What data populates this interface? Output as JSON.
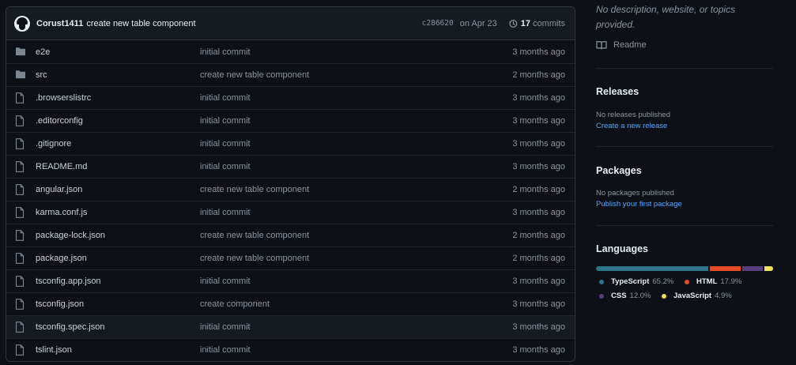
{
  "commit": {
    "author": "Corust1411",
    "message": "create new table component",
    "sha": "c286620",
    "date": "on Apr 23",
    "count": "17",
    "count_label": "commits"
  },
  "files": [
    {
      "name": "e2e",
      "type": "folder",
      "message": "initial commit",
      "age": "3 months ago"
    },
    {
      "name": "src",
      "type": "folder",
      "message": "create new table component",
      "age": "2 months ago"
    },
    {
      "name": ".browserslistrc",
      "type": "file",
      "message": "initial commit",
      "age": "3 months ago"
    },
    {
      "name": ".editorconfig",
      "type": "file",
      "message": "initial commit",
      "age": "3 months ago"
    },
    {
      "name": ".gitignore",
      "type": "file",
      "message": "initial commit",
      "age": "3 months ago"
    },
    {
      "name": "README.md",
      "type": "file",
      "message": "initial commit",
      "age": "3 months ago"
    },
    {
      "name": "angular.json",
      "type": "file",
      "message": "create new table component",
      "age": "2 months ago"
    },
    {
      "name": "karma.conf.js",
      "type": "file",
      "message": "initial commit",
      "age": "3 months ago"
    },
    {
      "name": "package-lock.json",
      "type": "file",
      "message": "create new table component",
      "age": "2 months ago"
    },
    {
      "name": "package.json",
      "type": "file",
      "message": "create new table component",
      "age": "2 months ago"
    },
    {
      "name": "tsconfig.app.json",
      "type": "file",
      "message": "initial commit",
      "age": "3 months ago"
    },
    {
      "name": "tsconfig.json",
      "type": "file",
      "message": "create component",
      "age": "3 months ago"
    },
    {
      "name": "tsconfig.spec.json",
      "type": "file",
      "message": "initial commit",
      "age": "3 months ago"
    },
    {
      "name": "tslint.json",
      "type": "file",
      "message": "initial commit",
      "age": "3 months ago"
    }
  ],
  "sidebar": {
    "description_line1": "No description, website, or topics",
    "description_line2": "provided.",
    "readme": "Readme",
    "releases": {
      "title": "Releases",
      "status": "No releases published",
      "link": "Create a new release"
    },
    "packages": {
      "title": "Packages",
      "status": "No packages published",
      "link": "Publish your first package"
    },
    "languages": {
      "title": "Languages",
      "items": [
        {
          "name": "TypeScript",
          "percent": "65.2%",
          "value": 65.2,
          "color": "#2b7489"
        },
        {
          "name": "HTML",
          "percent": "17.9%",
          "value": 17.9,
          "color": "#e34c26"
        },
        {
          "name": "CSS",
          "percent": "12.0%",
          "value": 12.0,
          "color": "#563d7c"
        },
        {
          "name": "JavaScript",
          "percent": "4.9%",
          "value": 4.9,
          "color": "#f1e05a"
        }
      ]
    }
  }
}
